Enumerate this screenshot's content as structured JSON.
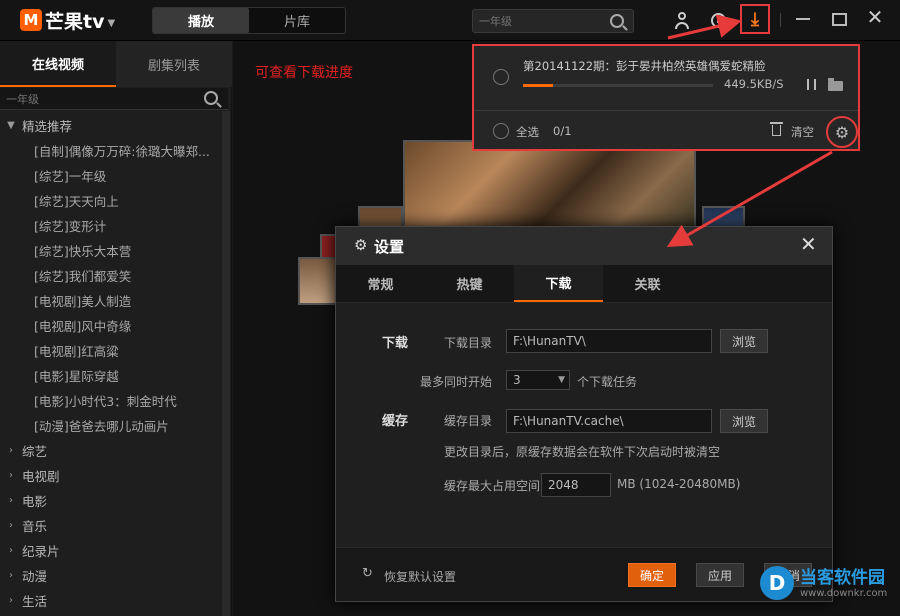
{
  "app": {
    "logo_text": "芒果tv",
    "logo_mark": "M"
  },
  "nav_tabs": [
    {
      "label": "播放",
      "active": true
    },
    {
      "label": "片库",
      "active": false
    }
  ],
  "search": {
    "placeholder": "一年级"
  },
  "tooltip": "下载",
  "annotation": "可查看下载进度",
  "sidebar": {
    "tabs": [
      {
        "label": "在线视频",
        "active": true
      },
      {
        "label": "剧集列表",
        "active": false
      }
    ],
    "search_placeholder": "一年级",
    "featured_label": "精选推荐",
    "featured_items": [
      "[自制]偶像万万碎:徐璐大曝郑...",
      "[综艺]一年级",
      "[综艺]天天向上",
      "[综艺]变形计",
      "[综艺]快乐大本营",
      "[综艺]我们都爱笑",
      "[电视剧]美人制造",
      "[电视剧]风中奇缘",
      "[电视剧]红高粱",
      "[电影]星际穿越",
      "[电影]小时代3：刺金时代",
      "[动漫]爸爸去哪儿动画片"
    ],
    "categories": [
      "综艺",
      "电视剧",
      "电影",
      "音乐",
      "纪录片",
      "动漫",
      "生活"
    ]
  },
  "download_panel": {
    "task_title": "第20141122期：彭于晏井柏然英雄偶爱蛇精脸",
    "speed": "449.5KB/S",
    "progress": 0.16,
    "select_all_label": "全选",
    "count": "0/1",
    "clear_label": "清空"
  },
  "settings": {
    "title": "设置",
    "tabs": [
      {
        "label": "常规",
        "active": false
      },
      {
        "label": "热键",
        "active": false
      },
      {
        "label": "下载",
        "active": true
      },
      {
        "label": "关联",
        "active": false
      }
    ],
    "download_section": "下载",
    "download_dir_label": "下载目录",
    "download_dir_value": "F:\\HunanTV\\",
    "browse_label": "浏览",
    "max_concurrent_label": "最多同时开始",
    "max_concurrent_value": "3",
    "max_concurrent_suffix": "个下载任务",
    "cache_section": "缓存",
    "cache_dir_label": "缓存目录",
    "cache_dir_value": "F:\\HunanTV.cache\\",
    "cache_note": "更改目录后，原缓存数据会在软件下次启动时被清空",
    "cache_max_label": "缓存最大占用空间",
    "cache_max_value": "2048",
    "cache_max_unit": "MB (1024-20480MB)",
    "restore_label": "恢复默认设置",
    "ok_label": "确定",
    "apply_label": "应用",
    "cancel_label": "取消"
  },
  "watermark": {
    "brand": "当客软件园",
    "url": "www.downkr.com",
    "logo": "D"
  },
  "colors": {
    "accent": "#ff6a00",
    "annotation_red": "#e53b3b"
  }
}
